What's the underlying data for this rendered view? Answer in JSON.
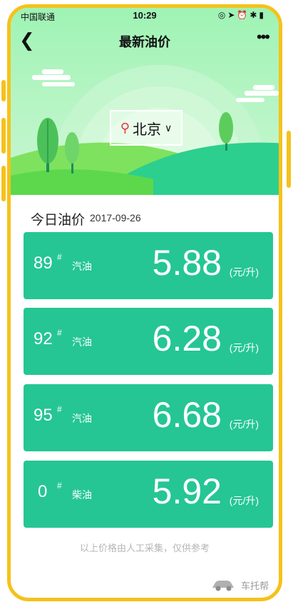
{
  "status_bar": {
    "carrier": "中国联通",
    "time": "10:29"
  },
  "nav": {
    "title": "最新油价"
  },
  "location": {
    "city": "北京"
  },
  "section": {
    "title": "今日油价",
    "date": "2017-09-26"
  },
  "prices": [
    {
      "grade": "89",
      "hash": "#",
      "type": "汽油",
      "price": "5.88",
      "unit": "(元/升)"
    },
    {
      "grade": "92",
      "hash": "#",
      "type": "汽油",
      "price": "6.28",
      "unit": "(元/升)"
    },
    {
      "grade": "95",
      "hash": "#",
      "type": "汽油",
      "price": "6.68",
      "unit": "(元/升)"
    },
    {
      "grade": "0",
      "hash": "#",
      "type": "柴油",
      "price": "5.92",
      "unit": "(元/升)"
    }
  ],
  "footnote": "以上价格由人工采集，仅供参考",
  "brand": "车托帮",
  "colors": {
    "frame": "#f5c21b",
    "card": "#25c693",
    "pin": "#e4383a",
    "banner": "#9ff3b4"
  },
  "icons": {
    "back": "chevron-left-icon",
    "more": "more-dots-icon",
    "pin": "location-pin-icon",
    "dropdown": "chevron-down-icon"
  }
}
